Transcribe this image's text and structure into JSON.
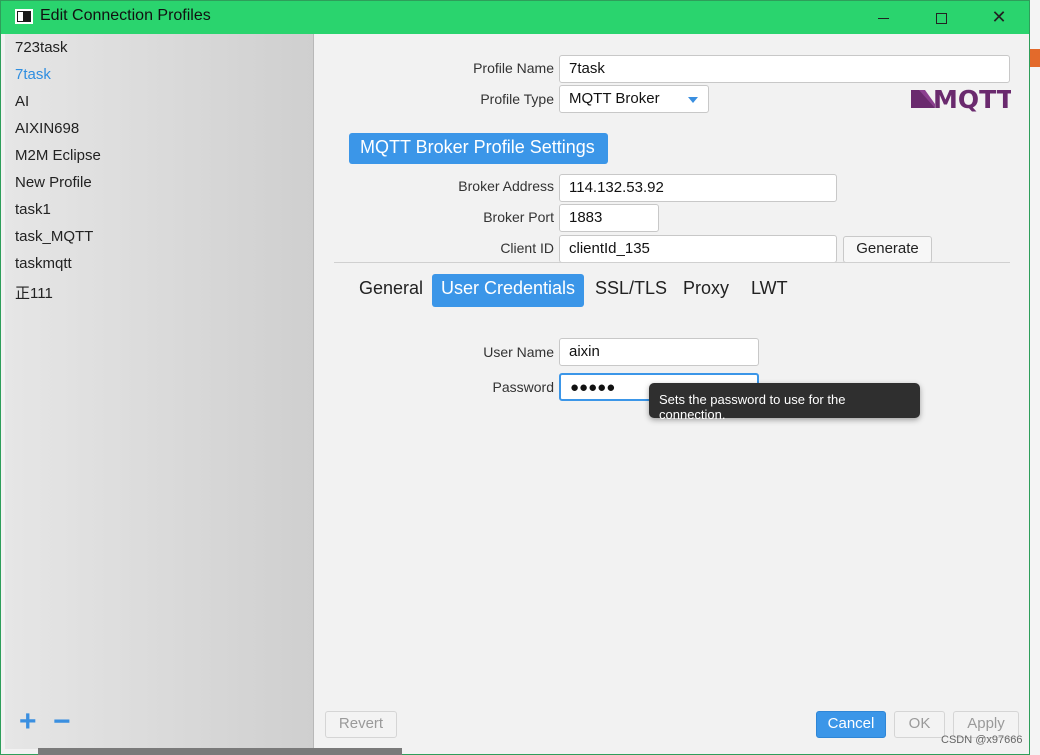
{
  "window": {
    "title": "Edit Connection Profiles"
  },
  "icons": {
    "app": "app-window-icon",
    "minimize": "minimize-icon",
    "maximize": "maximize-icon",
    "close": "close-icon",
    "add": "plus-icon",
    "remove": "minus-icon",
    "logo": "mqtt-logo",
    "dropdown": "chevron-down-icon"
  },
  "profiles": [
    "723task",
    "7task",
    "AI",
    "AIXIN698",
    "M2M Eclipse",
    "New Profile",
    "task1",
    "task_MQTT",
    "taskmqtt",
    "正111"
  ],
  "selected_profile": "7task",
  "form": {
    "profile_name_label": "Profile Name",
    "profile_name_value": "7task",
    "profile_type_label": "Profile Type",
    "profile_type_value": "MQTT Broker",
    "logo_text": "MQTT",
    "section_title": "MQTT Broker Profile Settings",
    "broker_address_label": "Broker Address",
    "broker_address_value": "114.132.53.92",
    "broker_port_label": "Broker Port",
    "broker_port_value": "1883",
    "client_id_label": "Client ID",
    "client_id_value": "clientId_135",
    "generate_label": "Generate"
  },
  "tabs": [
    "General",
    "User Credentials",
    "SSL/TLS",
    "Proxy",
    "LWT"
  ],
  "active_tab": "User Credentials",
  "credentials": {
    "username_label": "User Name",
    "username_value": "aixin",
    "password_label": "Password",
    "password_value": "●●●●●",
    "tooltip": "Sets the password to use for the connection."
  },
  "footer": {
    "revert": "Revert",
    "cancel": "Cancel",
    "ok": "OK",
    "apply": "Apply"
  },
  "watermark": "CSDN @x97666",
  "colors": {
    "titlebar": "#2ad46e",
    "accent": "#3b96e8"
  }
}
